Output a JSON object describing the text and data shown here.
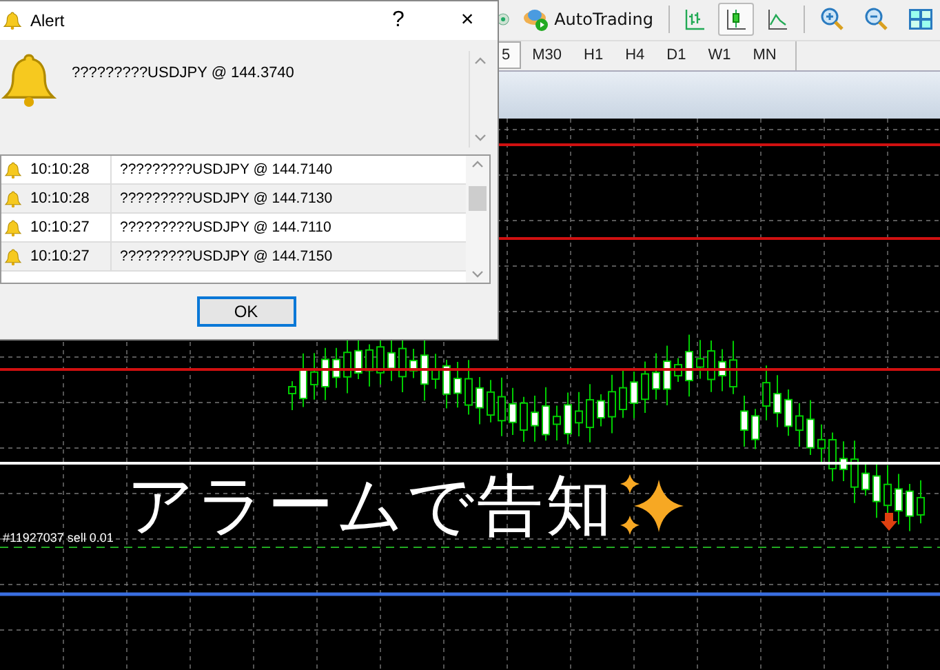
{
  "toolbar": {
    "autotrading": {
      "label": "AutoTrading"
    },
    "chart_modes": [
      {
        "kind": "bar",
        "selected": false
      },
      {
        "kind": "candle",
        "selected": true
      },
      {
        "kind": "line",
        "selected": false
      }
    ]
  },
  "timeframes": [
    {
      "label": "5",
      "selected": true
    },
    {
      "label": "M30",
      "selected": false
    },
    {
      "label": "H1",
      "selected": false
    },
    {
      "label": "H4",
      "selected": false
    },
    {
      "label": "D1",
      "selected": false
    },
    {
      "label": "W1",
      "selected": false
    },
    {
      "label": "MN",
      "selected": false
    }
  ],
  "chart": {
    "order_label": "#11927037 sell 0.01",
    "caption": "アラームで告知"
  },
  "alert_dialog": {
    "title": "Alert",
    "help": "?",
    "close": "×",
    "message": "?????????USDJPY @ 144.3740",
    "rows": [
      {
        "time": "10:10:28",
        "message": "?????????USDJPY @ 144.7140"
      },
      {
        "time": "10:10:28",
        "message": "?????????USDJPY @ 144.7130"
      },
      {
        "time": "10:10:27",
        "message": "?????????USDJPY @ 144.7110"
      },
      {
        "time": "10:10:27",
        "message": "?????????USDJPY @ 144.7150"
      }
    ],
    "ok": "OK"
  }
}
